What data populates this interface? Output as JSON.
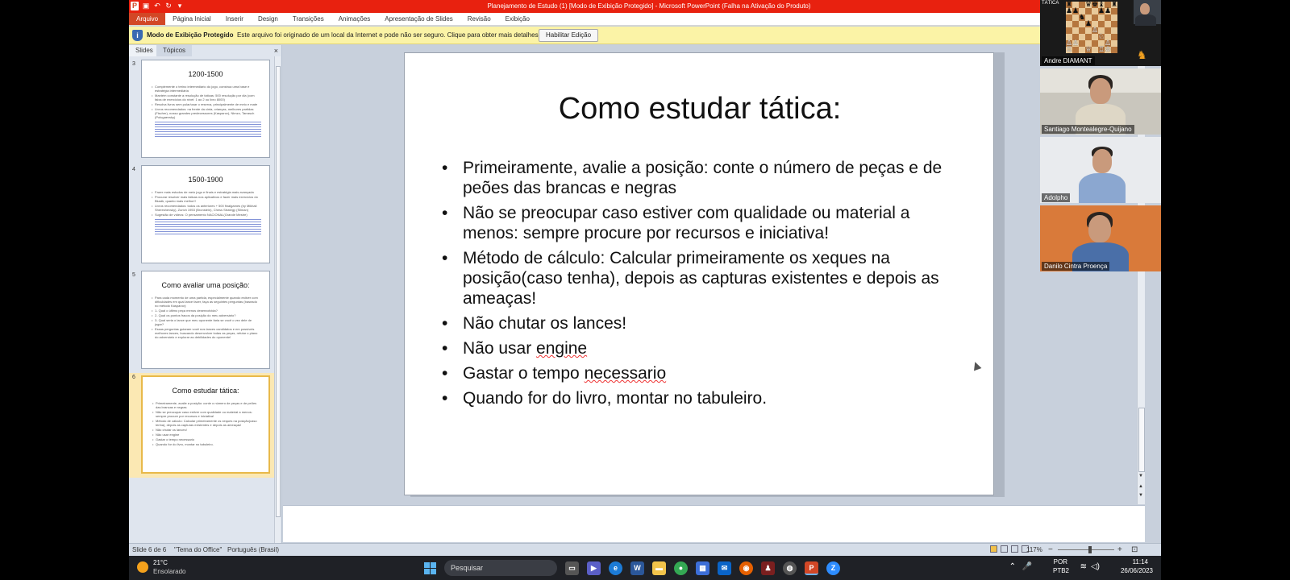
{
  "window": {
    "title": "Planejamento de Estudo (1) [Modo de Exibição Protegido] - Microsoft PowerPoint (Falha na Ativação do Produto)"
  },
  "ribbon": {
    "tabs": [
      "Arquivo",
      "Página Inicial",
      "Inserir",
      "Design",
      "Transições",
      "Animações",
      "Apresentação de Slides",
      "Revisão",
      "Exibição"
    ]
  },
  "protected_view": {
    "title": "Modo de Exibição Protegido",
    "message": "Este arquivo foi originado de um local da Internet e pode não ser seguro. Clique para obter mais detalhes.",
    "button": "Habilitar Edição"
  },
  "left_panel": {
    "tab_slides": "Slides",
    "tab_topics": "Tópicos",
    "close": "×"
  },
  "thumbnails": [
    {
      "num": "3",
      "title": "1200-1500",
      "bullets": [
        "Complemente o treino intermediário do jogo, construa uma base e estratégia intermediária",
        "Mantém constante a resolução de táticas: 500 resolução por dia (com faixa de exercícios do nível: 1 ao 2 ou livro 8000)",
        "Resolva livros sem pular/usar o reserva, principalmente de meio e mate",
        "Livros recomendados: na frente da cinta, crianças, melhores partidas (Fischer), nosso grandes predecessores (Kasparov), Nimzo, Tarrasch (Polugaevsky)"
      ]
    },
    {
      "num": "4",
      "title": "1500-1900",
      "bullets": [
        "Fazer mais estudos de meio jogo e finais e estratégia mais avançada",
        "Procurar resolver mais táticas nos aplicativos e fazer mais exercícios do Bkadk, quanto mais melhor!!",
        "Livros recomendados: todos os anteriores + 500 finalgames (by Mikhail Shereshevsky), Zurich 1953 (Bronstein), Chess Strategy (Silman)",
        "Sugestão de vídeos: O pensamento NACIONAL(Grande Mestre)"
      ]
    },
    {
      "num": "5",
      "title": "Como avaliar uma posição:",
      "bullets": [
        "Para cada momento de uma partida, especialmente quando estiver com dificuldades em qual lance fazer, faça as seguintes perguntas (baseado no método Kasparov):",
        "1- Qual o último peça menos desenvolvida?",
        "2- Qual os pontos fracos da posição do meu adversário?",
        "3- Qual seria o lance que meu oponente faria se você o vez dele de jogar?",
        "Essas perguntas guiaram você nos lances candidatos e em possíveis melhores lances, buscando desenvolver todas as peças, refutar o plano do adversário e explorar as debilidades do oponente!"
      ]
    },
    {
      "num": "6",
      "title": "Como estudar tática:",
      "bullets": [
        "Primeiramente, avalie a posição: conte o número de peças e de peões das brancas e negras",
        "Não se preocupar caso estiver com qualidade ou material a menos: sempre procure por recursos e iniciativa!",
        "Método de cálculo: Calcular primeiramente os xeques na posição(caso tenha), depois as capturas existentes e depois as ameaças!",
        "Não chutar os lances!",
        "Não usar engine",
        "Gastar o tempo necessario",
        "Quando for do livro, montar no tabuleiro."
      ]
    }
  ],
  "slide": {
    "title": "Como estudar tática:",
    "bullets": [
      "Primeiramente, avalie a posição: conte o número de peças e de peões das brancas e negras",
      "Não se preocupar caso estiver com qualidade ou material a menos: sempre procure por recursos e iniciativa!",
      "Método de cálculo: Calcular primeiramente os xeques na posição(caso tenha), depois as capturas existentes e depois as ameaças!",
      "Não chutar os lances!",
      "Não usar ",
      "Gastar o tempo ",
      "Quando for do livro, montar no tabuleiro."
    ],
    "bullet5_word": "engine",
    "bullet6_word": "necessario"
  },
  "status_bar": {
    "slide_info": "Slide 6 de 6",
    "theme": "\"Tema do Office\"",
    "language": "Português (Brasil)",
    "zoom": "117%",
    "zoom_minus": "−",
    "zoom_plus": "+"
  },
  "taskbar": {
    "temperature": "21°C",
    "weather": "Ensolarado",
    "search_placeholder": "Pesquisar",
    "lang_line1": "POR",
    "lang_line2": "PTB2",
    "time": "11:14",
    "date": "26/06/2023"
  },
  "participants": [
    {
      "name": "Andre DIAMANT",
      "label": "TÁTICA"
    },
    {
      "name": "Santiago Montealegre-Quijano"
    },
    {
      "name": "Adolpho"
    },
    {
      "name": "Danilo Cintra Proença"
    }
  ],
  "colors": {
    "titlebar": "#e8210f",
    "file_tab": "#d24726",
    "protected_bar": "#fbf3a6",
    "selected_thumb": "#e8b94a"
  }
}
